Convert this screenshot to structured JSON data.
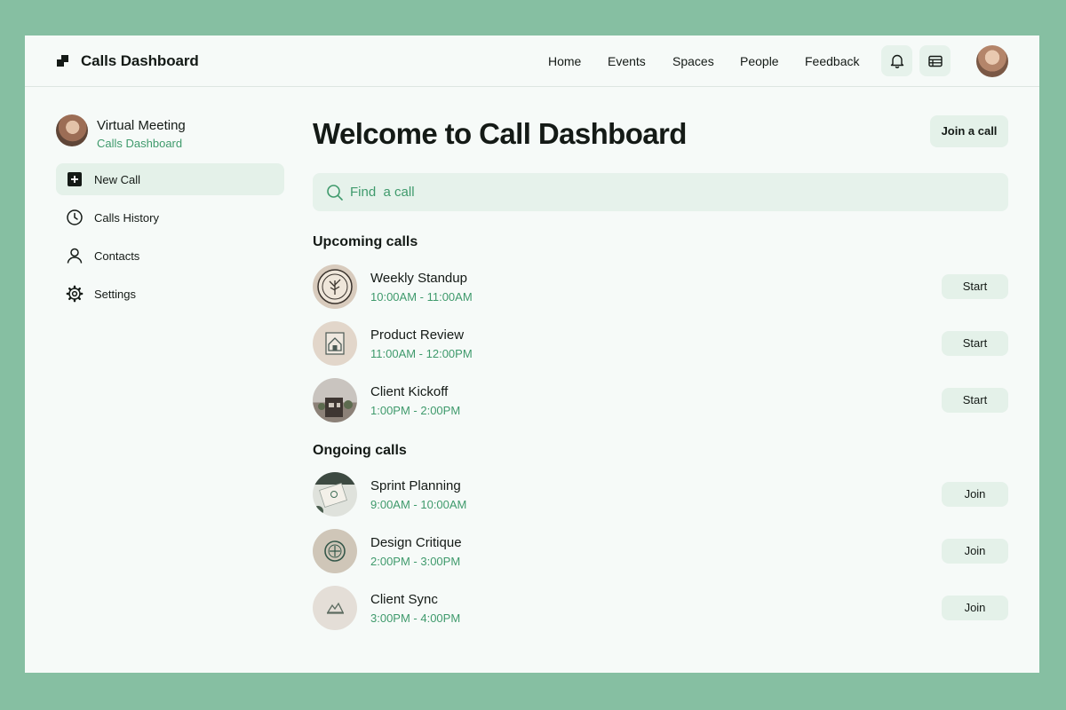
{
  "app": {
    "title": "Calls Dashboard"
  },
  "nav": [
    "Home",
    "Events",
    "Spaces",
    "People",
    "Feedback"
  ],
  "header_icons": [
    "bell-icon",
    "list-icon"
  ],
  "profile": {
    "name": "Virtual Meeting",
    "subtitle": "Calls Dashboard"
  },
  "sidebar": {
    "items": [
      {
        "label": "New Call",
        "icon": "plus-icon",
        "active": true
      },
      {
        "label": "Calls History",
        "icon": "clock-icon",
        "active": false
      },
      {
        "label": "Contacts",
        "icon": "user-icon",
        "active": false
      },
      {
        "label": "Settings",
        "icon": "gear-icon",
        "active": false
      }
    ]
  },
  "main": {
    "heading": "Welcome to Call Dashboard",
    "join_button": "Join a call",
    "search_placeholder": "Find  a call",
    "upcoming_title": "Upcoming calls",
    "ongoing_title": "Ongoing calls",
    "upcoming": [
      {
        "name": "Weekly Standup",
        "time": "10:00AM - 11:00AM",
        "action": "Start"
      },
      {
        "name": "Product Review",
        "time": "11:00AM - 12:00PM",
        "action": "Start"
      },
      {
        "name": "Client Kickoff",
        "time": "1:00PM - 2:00PM",
        "action": "Start"
      }
    ],
    "ongoing": [
      {
        "name": "Sprint Planning",
        "time": "9:00AM - 10:00AM",
        "action": "Join"
      },
      {
        "name": "Design Critique",
        "time": "2:00PM - 3:00PM",
        "action": "Join"
      },
      {
        "name": "Client Sync",
        "time": "3:00PM - 4:00PM",
        "action": "Join"
      }
    ]
  },
  "colors": {
    "outer_background": "#86bfa2",
    "window_background": "#f6faf8",
    "accent_green": "#3f9a6c",
    "button_background": "#e4f1e9",
    "text": "#141a16"
  }
}
